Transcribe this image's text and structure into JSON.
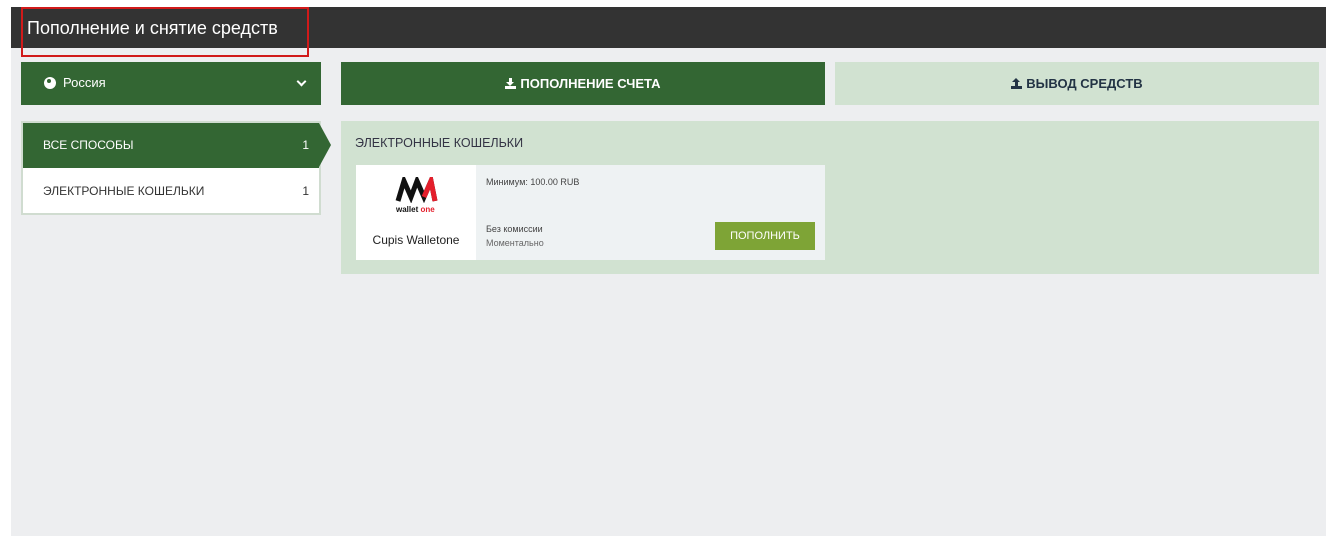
{
  "header": {
    "title": "Пополнение и снятие средств"
  },
  "country_selector": {
    "value": "Россия",
    "icon": "globe-icon",
    "dropdown_icon": "chevron-down-icon"
  },
  "tabs": {
    "deposit_label": "ПОПОЛНЕНИЕ СЧЕТА",
    "deposit_icon": "download-icon",
    "withdraw_label": "ВЫВОД СРЕДСТВ",
    "withdraw_icon": "upload-icon"
  },
  "sidebar": {
    "items": [
      {
        "label": "ВСЕ СПОСОБЫ",
        "count": "1",
        "active": true
      },
      {
        "label": "ЭЛЕКТРОННЫЕ КОШЕЛЬКИ",
        "count": "1",
        "active": false
      }
    ]
  },
  "panel": {
    "title": "ЭЛЕКТРОННЫЕ КОШЕЛЬКИ",
    "methods": [
      {
        "logo_text_a": "wallet",
        "logo_text_b": "one",
        "name": "Cupis Walletone",
        "minimum": "Минимум: 100.00 RUB",
        "fee": "Без комиссии",
        "speed": "Моментально",
        "button_label": "ПОПОЛНИТЬ"
      }
    ]
  },
  "colors": {
    "header_bg": "#333333",
    "primary_green": "#336633",
    "light_green": "#d1e2d1",
    "action_green": "#7ea436",
    "highlight_red": "#d11a1a",
    "brand_red": "#e41e2b"
  }
}
